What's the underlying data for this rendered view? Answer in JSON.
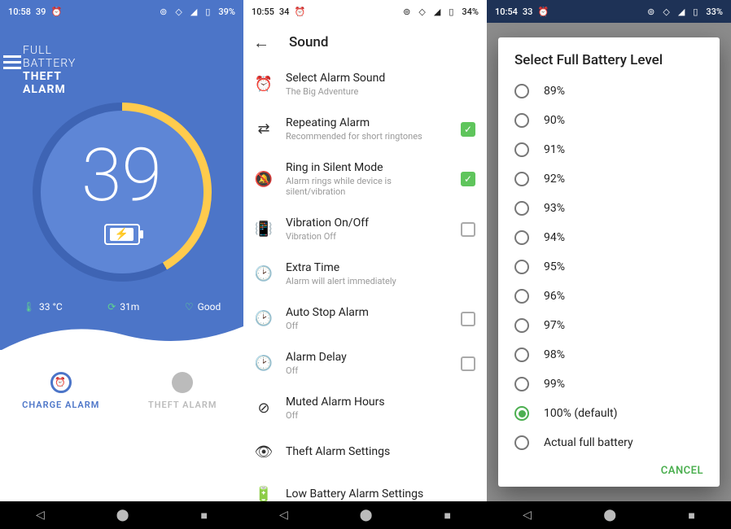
{
  "screens": {
    "home": {
      "status": {
        "time": "10:58",
        "temp": "39",
        "batt": "39%"
      },
      "logo": {
        "l1": "FULL",
        "l2": "BATTERY",
        "l3": "THEFT",
        "l4": "ALARM"
      },
      "battery_pct": "39",
      "stats": {
        "temp": "33 °C",
        "time": "31m",
        "health": "Good"
      },
      "tabs": {
        "charge": "CHARGE ALARM",
        "theft": "THEFT ALARM"
      }
    },
    "sound": {
      "status": {
        "time": "10:55",
        "temp": "34",
        "batt": "34%"
      },
      "title": "Sound",
      "items": [
        {
          "icon": "alarm",
          "title": "Select Alarm Sound",
          "sub": "The Big Adventure",
          "chk": null
        },
        {
          "icon": "repeat",
          "title": "Repeating Alarm",
          "sub": "Recommended for short ringtones",
          "chk": true
        },
        {
          "icon": "silent",
          "title": "Ring in Silent Mode",
          "sub": "Alarm rings while device is silent/vibration",
          "chk": true
        },
        {
          "icon": "vibrate",
          "title": "Vibration On/Off",
          "sub": "Vibration Off",
          "chk": false
        },
        {
          "icon": "clock",
          "title": "Extra Time",
          "sub": "Alarm will alert immediately",
          "chk": null
        },
        {
          "icon": "clock",
          "title": "Auto Stop Alarm",
          "sub": "Off",
          "chk": false
        },
        {
          "icon": "clock",
          "title": "Alarm Delay",
          "sub": "Off",
          "chk": false
        },
        {
          "icon": "mute-alarm",
          "title": "Muted Alarm Hours",
          "sub": "Off",
          "chk": null
        },
        {
          "icon": "eye",
          "title": "Theft Alarm Settings",
          "sub": "",
          "chk": null
        },
        {
          "icon": "battery",
          "title": "Low Battery Alarm Settings",
          "sub": "",
          "chk": null
        }
      ]
    },
    "dialog": {
      "status": {
        "time": "10:54",
        "temp": "33",
        "batt": "33%"
      },
      "title": "Select Full Battery Level",
      "options": [
        {
          "label": "89%",
          "selected": false
        },
        {
          "label": "90%",
          "selected": false
        },
        {
          "label": "91%",
          "selected": false
        },
        {
          "label": "92%",
          "selected": false
        },
        {
          "label": "93%",
          "selected": false
        },
        {
          "label": "94%",
          "selected": false
        },
        {
          "label": "95%",
          "selected": false
        },
        {
          "label": "96%",
          "selected": false
        },
        {
          "label": "97%",
          "selected": false
        },
        {
          "label": "98%",
          "selected": false
        },
        {
          "label": "99%",
          "selected": false
        },
        {
          "label": "100% (default)",
          "selected": true
        },
        {
          "label": "Actual full battery",
          "selected": false
        }
      ],
      "cancel": "CANCEL"
    }
  },
  "status_icons": "⟐ ⊚ ◬ ▮"
}
